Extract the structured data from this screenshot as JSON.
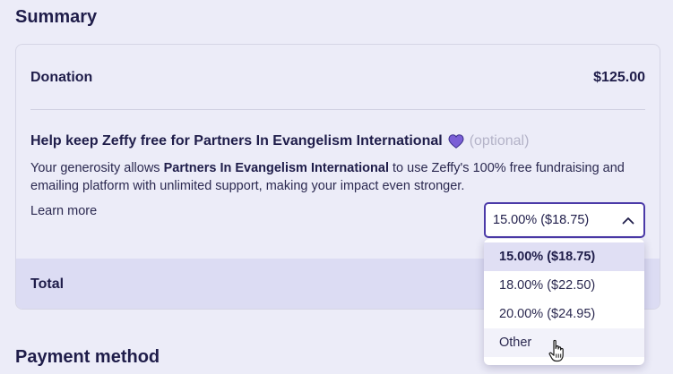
{
  "summary": {
    "title": "Summary"
  },
  "donation": {
    "label": "Donation",
    "amount": "$125.00"
  },
  "tip": {
    "title": "Help keep Zeffy free for Partners In Evangelism International",
    "optional": "(optional)",
    "desc_prefix": "Your generosity allows ",
    "org_name": "Partners In Evangelism International",
    "desc_suffix": " to use Zeffy's 100% free fundraising and emailing platform with unlimited support, making your impact even stronger.",
    "learn_more": "Learn more",
    "selected": "15.00% ($18.75)",
    "options": [
      "15.00% ($18.75)",
      "18.00% ($22.50)",
      "20.00% ($24.95)",
      "Other"
    ]
  },
  "total": {
    "label": "Total"
  },
  "payment": {
    "title": "Payment method"
  },
  "colors": {
    "accent": "#4b3aa8",
    "heart": "#7b5fd6",
    "total_bg": "#dcdcf3"
  },
  "icons": {
    "heart": "heart-icon",
    "chevron": "chevron-up-icon",
    "cursor": "hand-pointer-icon"
  }
}
